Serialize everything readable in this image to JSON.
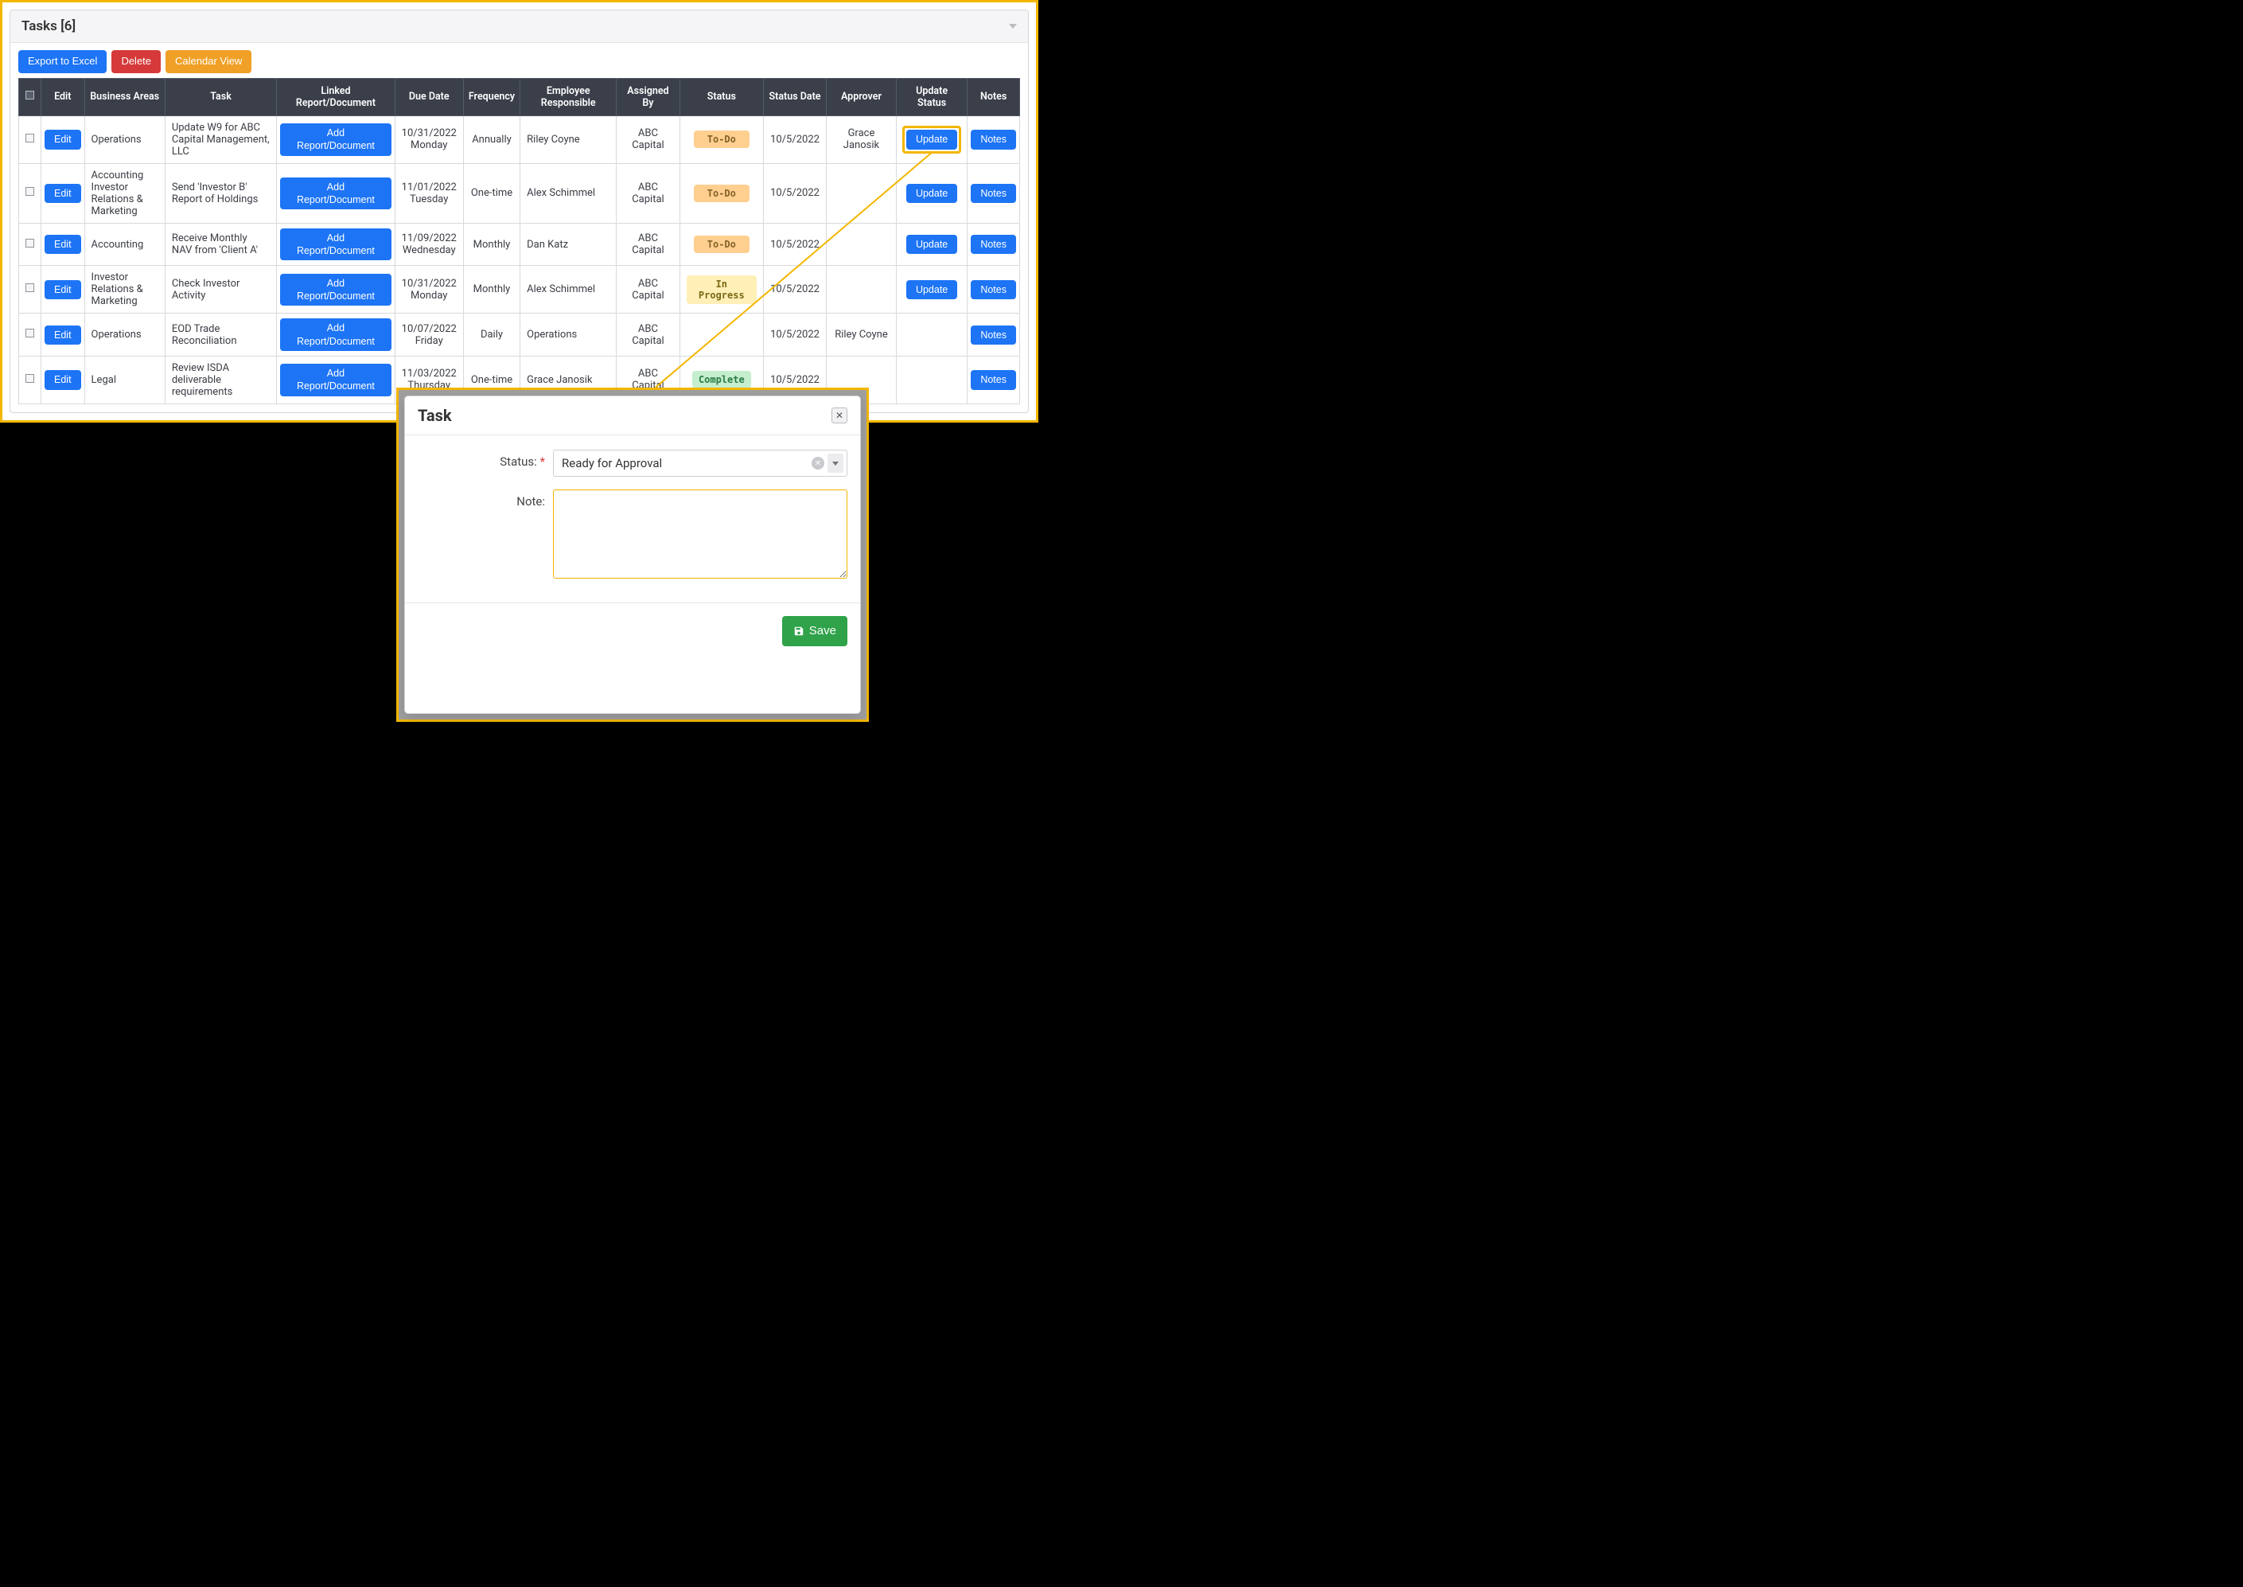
{
  "panel": {
    "title": "Tasks [6]",
    "buttons": {
      "export": "Export to Excel",
      "delete": "Delete",
      "calendar": "Calendar View"
    }
  },
  "columns": {
    "edit": "Edit",
    "biz": "Business Areas",
    "task": "Task",
    "linked": "Linked Report/Document",
    "due": "Due Date",
    "freq": "Frequency",
    "emp": "Employee Responsible",
    "asg": "Assigned By",
    "status": "Status",
    "sdate": "Status Date",
    "approver": "Approver",
    "upd": "Update Status",
    "notes": "Notes"
  },
  "labels": {
    "edit": "Edit",
    "addReport": "Add Report/Document",
    "update": "Update",
    "notes": "Notes"
  },
  "rows": [
    {
      "biz": "Operations",
      "task": "Update W9 for ABC Capital Management, LLC",
      "due1": "10/31/2022",
      "due2": "Monday",
      "freq": "Annually",
      "emp": "Riley Coyne",
      "asg": "ABC Capital",
      "status": "To-Do",
      "statusClass": "todo",
      "sdate": "10/5/2022",
      "approver": "Grace Janosik",
      "showUpdate": true
    },
    {
      "biz": "Accounting Investor Relations & Marketing",
      "task": "Send 'Investor B' Report of Holdings",
      "due1": "11/01/2022",
      "due2": "Tuesday",
      "freq": "One-time",
      "emp": "Alex Schimmel",
      "asg": "ABC Capital",
      "status": "To-Do",
      "statusClass": "todo",
      "sdate": "10/5/2022",
      "approver": "",
      "showUpdate": true
    },
    {
      "biz": "Accounting",
      "task": "Receive Monthly NAV from 'Client A'",
      "due1": "11/09/2022",
      "due2": "Wednesday",
      "freq": "Monthly",
      "emp": "Dan Katz",
      "asg": "ABC Capital",
      "status": "To-Do",
      "statusClass": "todo",
      "sdate": "10/5/2022",
      "approver": "",
      "showUpdate": true
    },
    {
      "biz": "Investor Relations & Marketing",
      "task": "Check Investor Activity",
      "due1": "10/31/2022",
      "due2": "Monday",
      "freq": "Monthly",
      "emp": "Alex Schimmel",
      "asg": "ABC Capital",
      "status": "In Progress",
      "statusClass": "progress",
      "sdate": "10/5/2022",
      "approver": "",
      "showUpdate": true
    },
    {
      "biz": "Operations",
      "task": "EOD Trade Reconciliation",
      "due1": "10/07/2022",
      "due2": "Friday",
      "freq": "Daily",
      "emp": "Operations",
      "asg": "ABC Capital",
      "status": "",
      "statusClass": "",
      "sdate": "10/5/2022",
      "approver": "Riley Coyne",
      "showUpdate": false
    },
    {
      "biz": "Legal",
      "task": "Review ISDA deliverable requirements",
      "due1": "11/03/2022",
      "due2": "Thursday",
      "freq": "One-time",
      "emp": "Grace Janosik",
      "asg": "ABC Capital",
      "status": "Complete",
      "statusClass": "complete",
      "sdate": "10/5/2022",
      "approver": "",
      "showUpdate": false
    }
  ],
  "modal": {
    "title": "Task",
    "statusLabel": "Status:",
    "statusValue": "Ready for Approval",
    "noteLabel": "Note:",
    "noteValue": "",
    "save": "Save"
  }
}
